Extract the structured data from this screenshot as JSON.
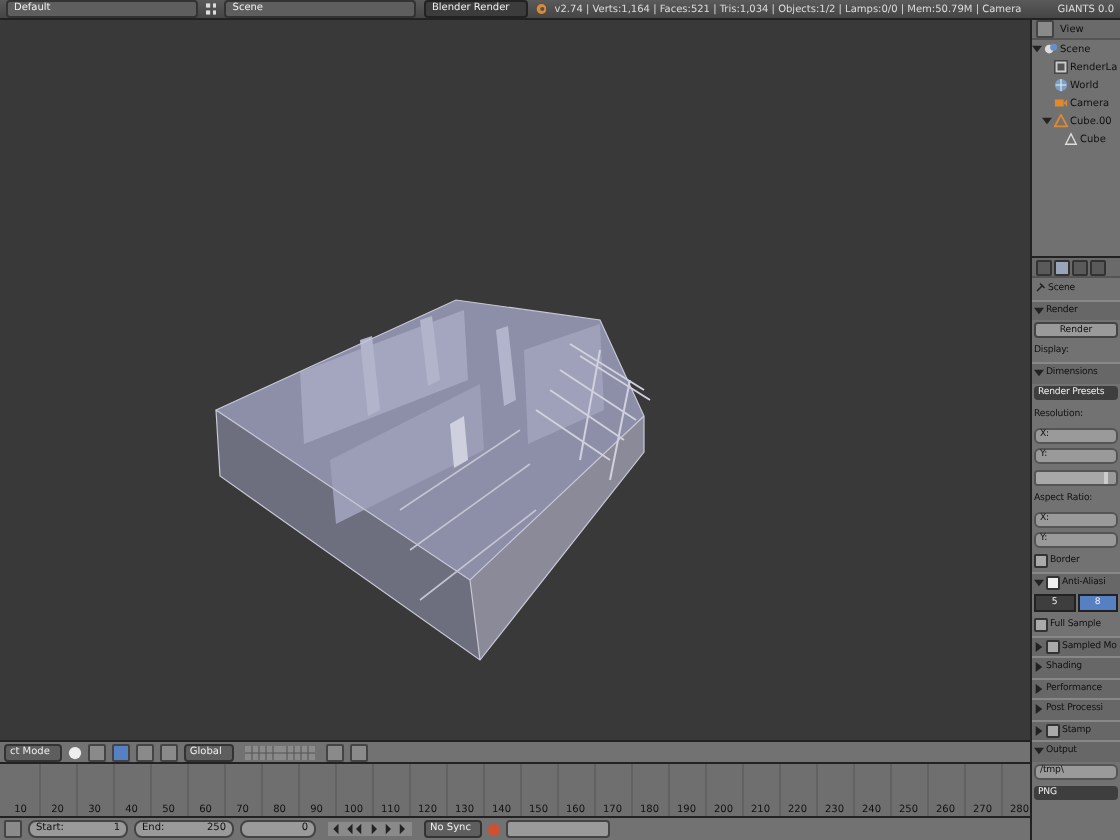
{
  "info_header": {
    "layout": "Default",
    "scene": "Scene",
    "engine": "Blender Render",
    "stats": "v2.74 | Verts:1,164 | Faces:521 | Tris:1,034 | Objects:1/2 | Lamps:0/0 | Mem:50.79M | Camera",
    "addon": "GIANTS 0.0"
  },
  "outliner": {
    "menu": "View",
    "tree": [
      {
        "label": "Scene",
        "kind": "scene",
        "expanded": true,
        "children": [
          {
            "label": "RenderLa",
            "kind": "render_layers"
          },
          {
            "label": "World",
            "kind": "world"
          },
          {
            "label": "Camera",
            "kind": "camera"
          },
          {
            "label": "Cube.00",
            "kind": "object",
            "expanded": true,
            "children": [
              {
                "label": "Cube",
                "kind": "mesh"
              }
            ]
          }
        ]
      }
    ]
  },
  "properties": [
    {
      "kind": "context",
      "label": "Scene"
    },
    {
      "kind": "panel",
      "label": "Render",
      "expanded": true
    },
    {
      "kind": "button",
      "label": "Render"
    },
    {
      "kind": "label",
      "label": "Display:"
    },
    {
      "kind": "panel",
      "label": "Dimensions",
      "expanded": true
    },
    {
      "kind": "menu",
      "label": "Render Presets"
    },
    {
      "kind": "label",
      "label": "Resolution:"
    },
    {
      "kind": "field",
      "label": "X:"
    },
    {
      "kind": "field",
      "label": "Y:"
    },
    {
      "kind": "slider",
      "level": 0.9
    },
    {
      "kind": "label",
      "label": "Aspect Ratio:"
    },
    {
      "kind": "field",
      "label": "X:"
    },
    {
      "kind": "field",
      "label": "Y:"
    },
    {
      "kind": "checkbox",
      "label": "Border",
      "checked": false
    },
    {
      "kind": "check_panel",
      "label": "Anti-Aliasi",
      "expanded": true,
      "checked": true
    },
    {
      "kind": "segments",
      "options": [
        {
          "label": "5",
          "selected": false
        },
        {
          "label": "8",
          "selected": true
        }
      ]
    },
    {
      "kind": "checkbox",
      "label": "Full Sample",
      "checked": false
    },
    {
      "kind": "check_panel",
      "label": "Sampled Mo",
      "expanded": false,
      "checked": false
    },
    {
      "kind": "panel",
      "label": "Shading",
      "expanded": false
    },
    {
      "kind": "panel",
      "label": "Performance",
      "expanded": false
    },
    {
      "kind": "panel",
      "label": "Post Processi",
      "expanded": false
    },
    {
      "kind": "check_panel",
      "label": "Stamp",
      "expanded": false,
      "checked": false
    },
    {
      "kind": "panel",
      "label": "Output",
      "expanded": true
    },
    {
      "kind": "path",
      "label": "/tmp\\"
    },
    {
      "kind": "format",
      "label": "PNG"
    }
  ],
  "view3d_header": {
    "mode": "ct Mode",
    "orientation": "Global"
  },
  "timeline": {
    "frame_labels": [
      "10",
      "20",
      "30",
      "40",
      "50",
      "60",
      "70",
      "80",
      "90",
      "100",
      "110",
      "120",
      "130",
      "140",
      "150",
      "160",
      "170",
      "180",
      "190",
      "200",
      "210",
      "220",
      "230",
      "240",
      "250",
      "260",
      "270",
      "280"
    ]
  },
  "timeline_header": {
    "start_label": "Start:",
    "start": "1",
    "end_label": "End:",
    "end": "250",
    "current": "0",
    "sync": "No Sync"
  }
}
